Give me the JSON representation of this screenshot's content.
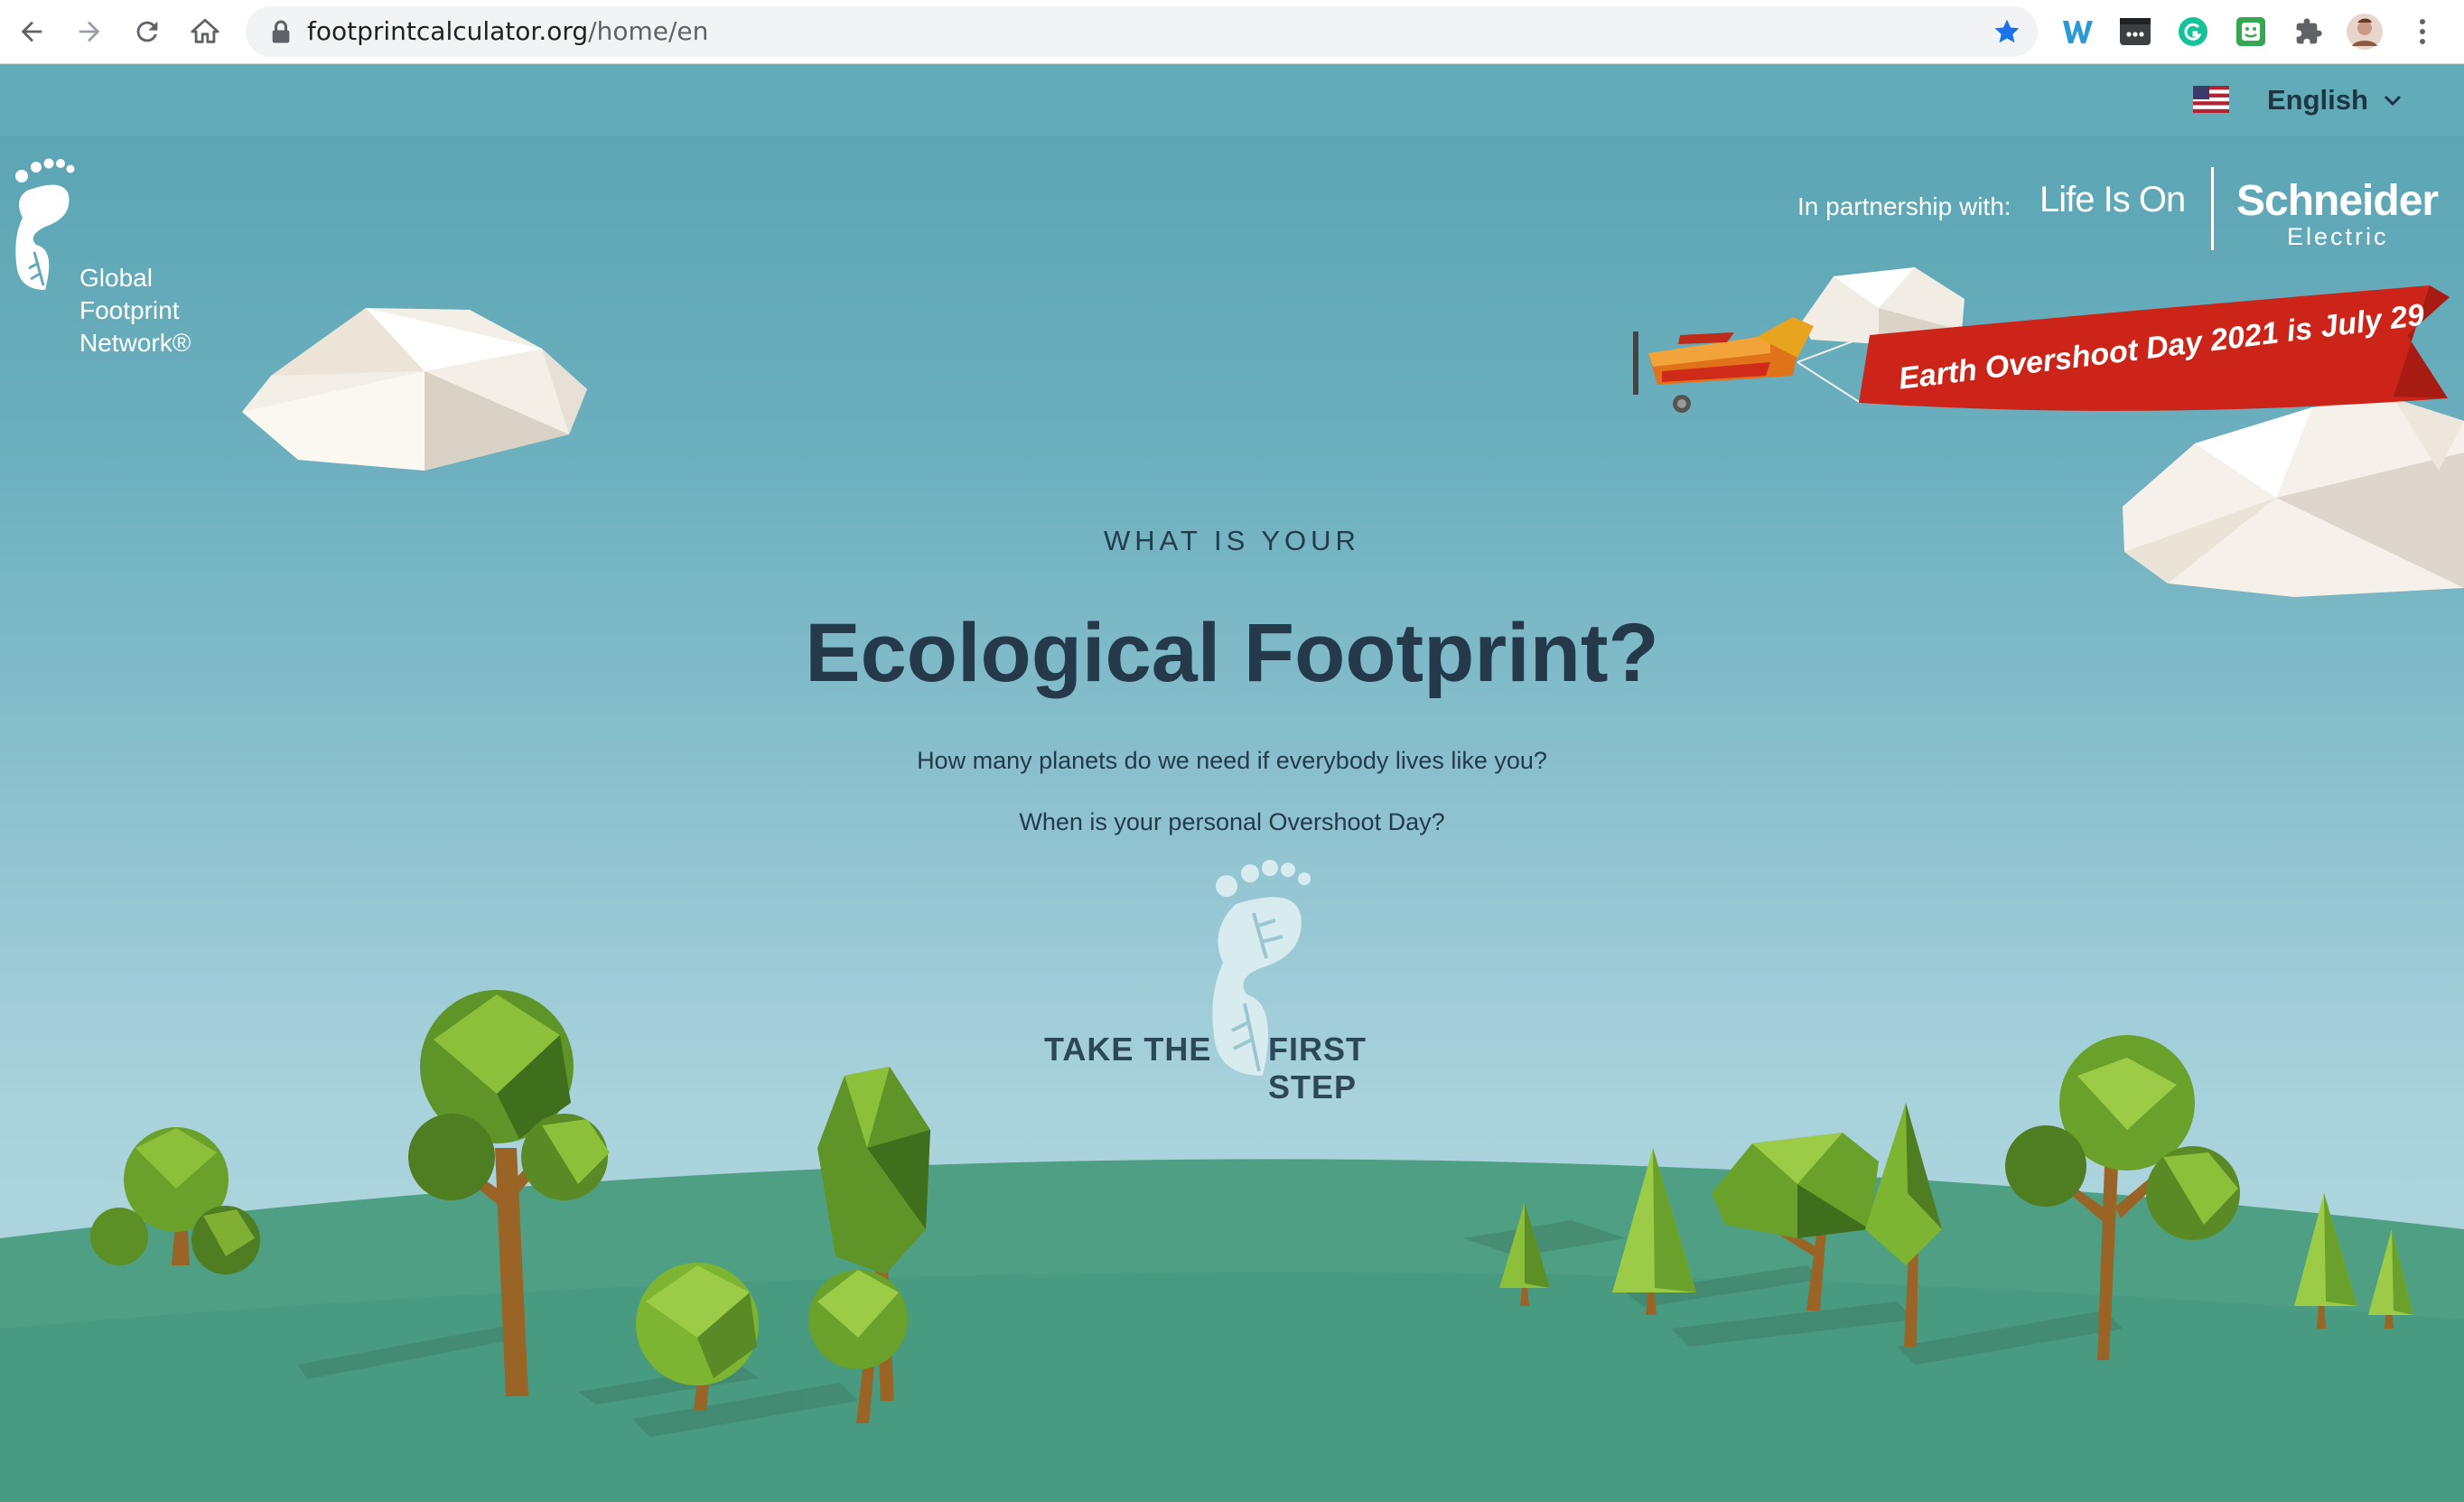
{
  "browser": {
    "url_host": "footprintcalculator.org",
    "url_path": "/home/en",
    "icons": [
      "back-icon",
      "forward-icon",
      "reload-icon",
      "home-icon",
      "lock-icon",
      "star-icon",
      "extension-w-icon",
      "extension-dots-icon",
      "grammarly-icon",
      "extension-green-icon",
      "puzzle-icon",
      "profile-avatar",
      "menu-icon"
    ],
    "colors": {
      "chrome_bg": "#ffffff",
      "urlbar_bg": "#f1f3f4",
      "star": "#1a73e8"
    }
  },
  "language": {
    "selected": "English",
    "flag": "us-flag-icon"
  },
  "logo": {
    "lines": [
      "Global",
      "Footprint",
      "Network®"
    ]
  },
  "partner": {
    "label": "In partnership with:",
    "life_is_on": "Life Is On",
    "brand": "Schneider",
    "brand_sub": "Electric"
  },
  "banner": {
    "text": "Earth Overshoot Day 2021 is July 29",
    "color": "#cc2418"
  },
  "hero": {
    "pre_title": "WHAT IS YOUR",
    "title": "Ecological Footprint?",
    "question1": "How many planets do we need if everybody lives like you?",
    "question2": "When is your personal Overshoot Day?"
  },
  "cta": {
    "left": "TAKE THE",
    "right": "FIRST STEP"
  },
  "colors": {
    "sky_top": "#58a3b2",
    "sky_bottom": "#b5d9e1",
    "ground": "#4a9a80",
    "text_dark": "#243a4b",
    "tree_green": "#6aa12b",
    "trunk": "#9a6426"
  }
}
